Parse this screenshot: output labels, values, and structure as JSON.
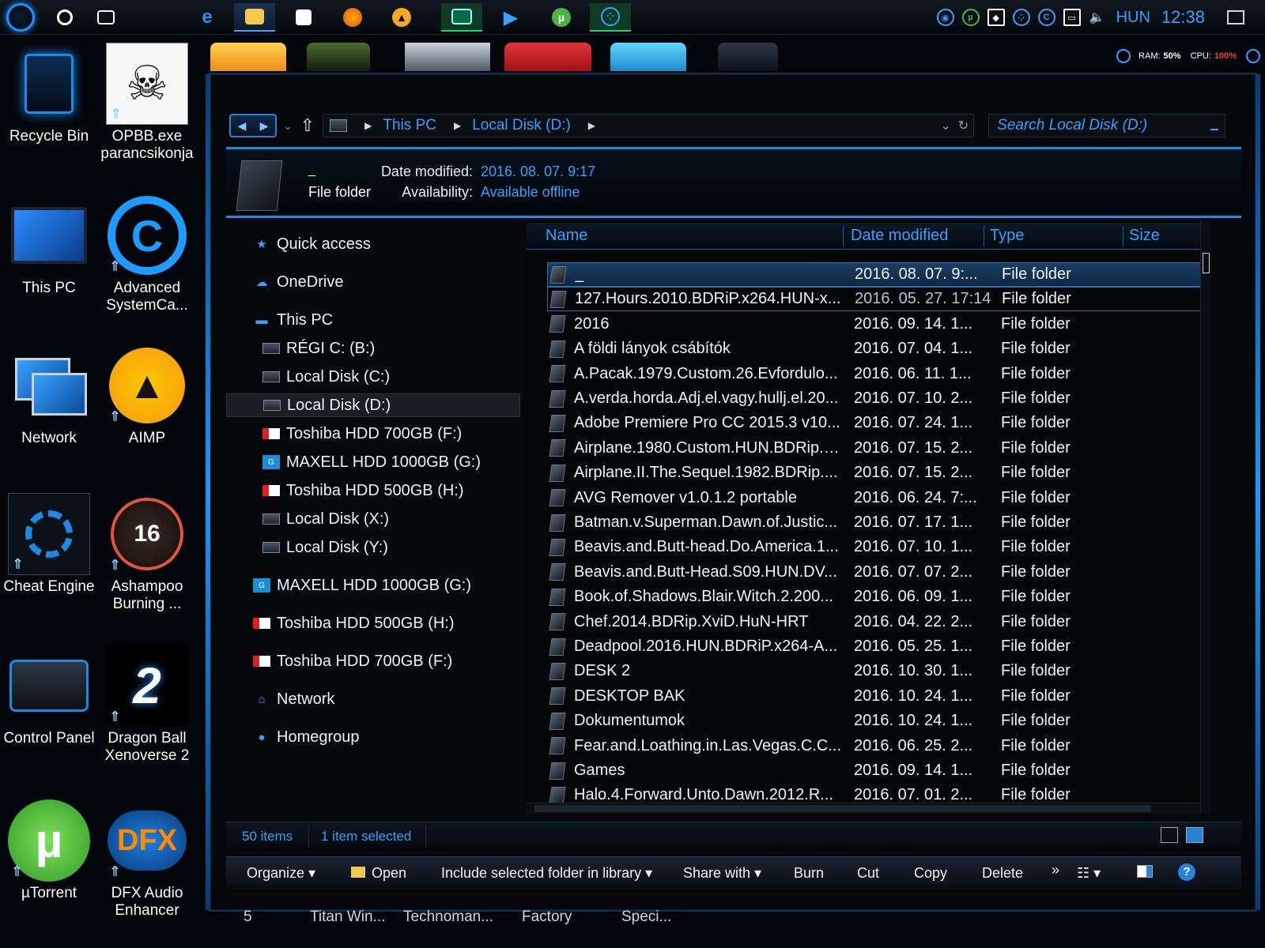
{
  "taskbar": {
    "tray_lang": "HUN",
    "tray_clock": "12:38"
  },
  "sysmon": {
    "ram_label": "RAM:",
    "ram_value": "50%",
    "cpu_label": "CPU:",
    "cpu_value": "100%"
  },
  "desktop": {
    "recycle_bin": "Recycle Bin",
    "opbb_1": "OPBB.exe",
    "opbb_2": "parancsikonja",
    "this_pc": "This PC",
    "advanced_1": "Advanced",
    "advanced_2": "SystemCa...",
    "network": "Network",
    "aimp": "AIMP",
    "cheat_engine": "Cheat Engine",
    "ashampoo_1": "Ashampoo",
    "ashampoo_2": "Burning ...",
    "ashampoo_badge": "16",
    "control_panel": "Control Panel",
    "dragonball_1": "Dragon Ball",
    "dragonball_2": "Xenoverse 2",
    "xv2_badge": "2",
    "utorrent": "µTorrent",
    "dfx_1": "DFX Audio",
    "dfx_2": "Enhancer",
    "dfx_badge": "DFX"
  },
  "address": {
    "crumb_1": "This PC",
    "crumb_2": "Local Disk (D:)",
    "search_placeholder": "Search Local Disk (D:)"
  },
  "details": {
    "name": "_",
    "kind": "File folder",
    "date_label": "Date modified:",
    "date_value": "2016. 08. 07. 9:17",
    "avail_label": "Availability:",
    "avail_value": "Available offline"
  },
  "navpane": [
    {
      "label": "Quick access",
      "icon": "star-icon"
    },
    {
      "label": "OneDrive",
      "icon": "cloud-icon"
    },
    {
      "label": "This PC",
      "icon": "computer-icon"
    },
    {
      "label": "RÉGI C: (B:)",
      "icon": "hdd-icon"
    },
    {
      "label": "Local Disk (C:)",
      "icon": "hdd-icon"
    },
    {
      "label": "Local Disk (D:)",
      "icon": "hdd-icon"
    },
    {
      "label": "Toshiba HDD 700GB (F:)",
      "icon": "red-drive-icon"
    },
    {
      "label": "MAXELL HDD 1000GB (G:)",
      "icon": "cyan-drive-icon"
    },
    {
      "label": "Toshiba HDD 500GB (H:)",
      "icon": "red-drive-icon"
    },
    {
      "label": "Local Disk (X:)",
      "icon": "hdd-icon"
    },
    {
      "label": "Local Disk (Y:)",
      "icon": "hdd-icon"
    },
    {
      "label": "MAXELL HDD 1000GB (G:)",
      "icon": "cyan-drive-icon"
    },
    {
      "label": "Toshiba HDD 500GB (H:)",
      "icon": "red-drive-icon"
    },
    {
      "label": "Toshiba HDD 700GB (F:)",
      "icon": "red-drive-icon"
    },
    {
      "label": "Network",
      "icon": "network-icon"
    },
    {
      "label": "Homegroup",
      "icon": "homegroup-icon"
    }
  ],
  "columns": {
    "name": "Name",
    "date": "Date modified",
    "type": "Type",
    "size": "Size"
  },
  "files": [
    {
      "name": "_",
      "date": "2016. 08. 07. 9:...",
      "type": "File folder"
    },
    {
      "name": "127.Hours.2010.BDRiP.x264.HUN-x...",
      "date": "2016. 05. 27. 17:14",
      "type": "File folder"
    },
    {
      "name": "2016",
      "date": "2016. 09. 14. 1...",
      "type": "File folder"
    },
    {
      "name": "A földi lányok csábítók",
      "date": "2016. 07. 04. 1...",
      "type": "File folder"
    },
    {
      "name": "A.Pacak.1979.Custom.26.Evfordulo...",
      "date": "2016. 06. 11. 1...",
      "type": "File folder"
    },
    {
      "name": "A.verda.horda.Adj.el.vagy.hullj.el.20...",
      "date": "2016. 07. 10. 2...",
      "type": "File folder"
    },
    {
      "name": "Adobe Premiere Pro CC 2015.3 v10...",
      "date": "2016. 07. 24. 1...",
      "type": "File folder"
    },
    {
      "name": "Airplane.1980.Custom.HUN.BDRip.X...",
      "date": "2016. 07. 15. 2...",
      "type": "File folder"
    },
    {
      "name": "Airplane.II.The.Sequel.1982.BDRip....",
      "date": "2016. 07. 15. 2...",
      "type": "File folder"
    },
    {
      "name": "AVG Remover v1.0.1.2 portable",
      "date": "2016. 06. 24. 7:...",
      "type": "File folder"
    },
    {
      "name": "Batman.v.Superman.Dawn.of.Justic...",
      "date": "2016. 07. 17. 1...",
      "type": "File folder"
    },
    {
      "name": "Beavis.and.Butt-head.Do.America.1...",
      "date": "2016. 07. 10. 1...",
      "type": "File folder"
    },
    {
      "name": "Beavis.and.Butt-Head.S09.HUN.DV...",
      "date": "2016. 07. 07. 2...",
      "type": "File folder"
    },
    {
      "name": "Book.of.Shadows.Blair.Witch.2.200...",
      "date": "2016. 06. 09. 1...",
      "type": "File folder"
    },
    {
      "name": "Chef.2014.BDRip.XviD.HuN-HRT",
      "date": "2016. 04. 22. 2...",
      "type": "File folder"
    },
    {
      "name": "Deadpool.2016.HUN.BDRiP.x264-A...",
      "date": "2016. 05. 25. 1...",
      "type": "File folder"
    },
    {
      "name": "DESK 2",
      "date": "2016. 10. 30. 1...",
      "type": "File folder"
    },
    {
      "name": "DESKTOP BAK",
      "date": "2016. 10. 24. 1...",
      "type": "File folder"
    },
    {
      "name": "Dokumentumok",
      "date": "2016. 10. 24. 1...",
      "type": "File folder"
    },
    {
      "name": "Fear.and.Loathing.in.Las.Vegas.C.C...",
      "date": "2016. 06. 25. 2...",
      "type": "File folder"
    },
    {
      "name": "Games",
      "date": "2016. 09. 14. 1...",
      "type": "File folder"
    },
    {
      "name": "Halo.4.Forward.Unto.Dawn.2012.R...",
      "date": "2016. 07. 01. 2...",
      "type": "File folder"
    }
  ],
  "status": {
    "items": "50 items",
    "selected": "1 item selected"
  },
  "commands": {
    "organize": "Organize",
    "open": "Open",
    "include": "Include selected folder in library",
    "share": "Share with",
    "burn": "Burn",
    "cut": "Cut",
    "copy": "Copy",
    "delete": "Delete",
    "more": "»",
    "help": "?"
  },
  "behind": {
    "t1": "5",
    "t2": "Titan Win...",
    "t3": "Technoman...",
    "t4": "Factory",
    "t5": "Speci..."
  }
}
